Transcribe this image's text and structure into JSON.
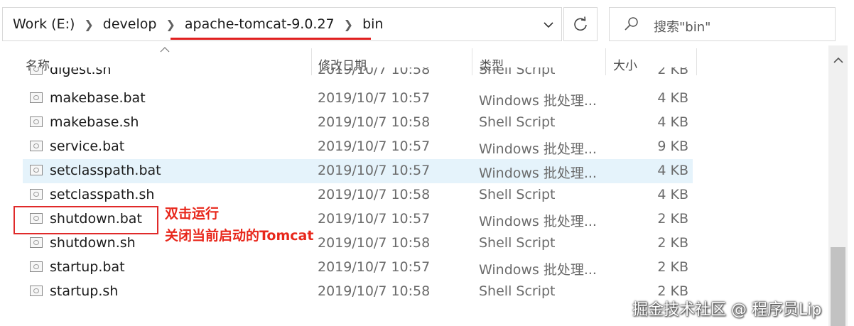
{
  "address_bar": {
    "crumbs": [
      "Work (E:)",
      "develop",
      "apache-tomcat-9.0.27",
      "bin"
    ]
  },
  "search": {
    "placeholder": "搜索\"bin\""
  },
  "columns": {
    "name": "名称",
    "date": "修改日期",
    "type": "类型",
    "size": "大小"
  },
  "partial_row": {
    "name": "digest.sh",
    "date": "2019/10/7 10:58",
    "type": "Shell Script",
    "size": "2 KB"
  },
  "files": [
    {
      "name": "makebase.bat",
      "date": "2019/10/7 10:57",
      "type": "Windows 批处理...",
      "size": "4 KB"
    },
    {
      "name": "makebase.sh",
      "date": "2019/10/7 10:58",
      "type": "Shell Script",
      "size": "4 KB"
    },
    {
      "name": "service.bat",
      "date": "2019/10/7 10:57",
      "type": "Windows 批处理...",
      "size": "9 KB"
    },
    {
      "name": "setclasspath.bat",
      "date": "2019/10/7 10:57",
      "type": "Windows 批处理...",
      "size": "4 KB"
    },
    {
      "name": "setclasspath.sh",
      "date": "2019/10/7 10:58",
      "type": "Shell Script",
      "size": "4 KB"
    },
    {
      "name": "shutdown.bat",
      "date": "2019/10/7 10:57",
      "type": "Windows 批处理...",
      "size": "2 KB"
    },
    {
      "name": "shutdown.sh",
      "date": "2019/10/7 10:58",
      "type": "Shell Script",
      "size": "2 KB"
    },
    {
      "name": "startup.bat",
      "date": "2019/10/7 10:57",
      "type": "Windows 批处理...",
      "size": "2 KB"
    },
    {
      "name": "startup.sh",
      "date": "2019/10/7 10:58",
      "type": "Shell Script",
      "size": "2 KB"
    }
  ],
  "annotation": {
    "line1": "双击运行",
    "line2": "关闭当前启动的Tomcat",
    "color": "#e8271b"
  },
  "watermark": "掘金技术社区 @ 程序员Lip"
}
